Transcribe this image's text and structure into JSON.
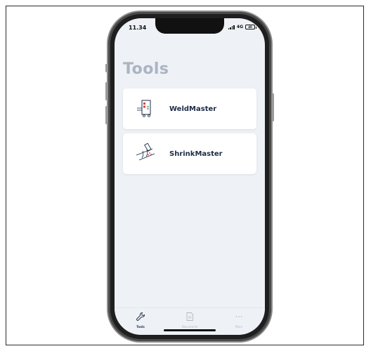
{
  "status_bar": {
    "time": "11.34",
    "network": "4G",
    "battery": "40"
  },
  "page": {
    "title": "Tools"
  },
  "tools": [
    {
      "name": "WeldMaster",
      "icon": "weld-machine-icon"
    },
    {
      "name": "ShrinkMaster",
      "icon": "shrink-torch-icon"
    }
  ],
  "tabbar": {
    "tabs": [
      {
        "label": "Tools",
        "icon": "wrench-icon",
        "active": true
      },
      {
        "label": "Documents",
        "icon": "document-icon",
        "active": false
      },
      {
        "label": "More",
        "icon": "more-dots-icon",
        "active": false
      }
    ]
  },
  "colors": {
    "active": "#1c2b45",
    "inactive": "#b3bac5",
    "background": "#eef1f5",
    "title": "#aab4c3"
  }
}
